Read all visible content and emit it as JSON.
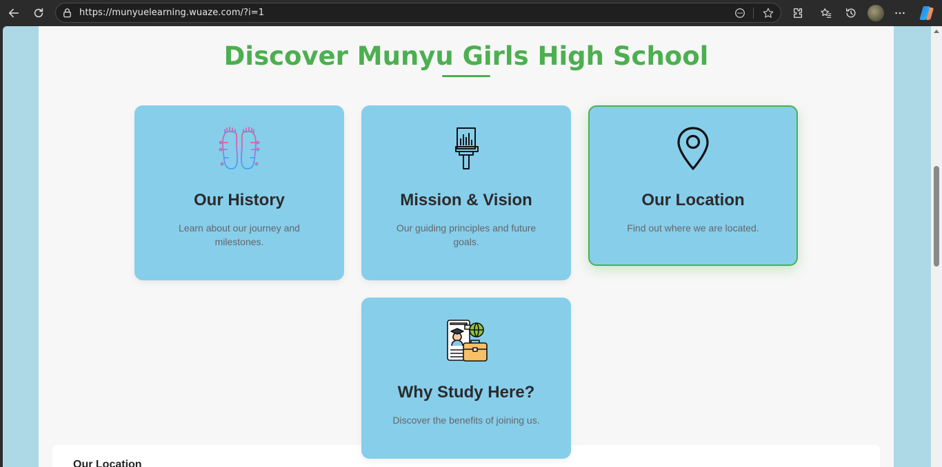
{
  "browser": {
    "url": "https://munyuelearning.wuaze.com/?i=1"
  },
  "page": {
    "title": "Discover Munyu Girls High School",
    "accent_color": "#4caf50",
    "card_color": "#87ceeb",
    "cards": [
      {
        "icon": "feet-icon",
        "title": "Our History",
        "desc": "Learn about our journey and milestones."
      },
      {
        "icon": "paint-brush-icon",
        "title": "Mission & Vision",
        "desc": "Our guiding principles and future goals."
      },
      {
        "icon": "location-pin-icon",
        "title": "Our Location",
        "desc": "Find out where we are located."
      },
      {
        "icon": "study-abroad-icon",
        "title": "Why Study Here?",
        "desc": "Discover the benefits of joining us."
      }
    ],
    "lower_section_title": "Our Location"
  }
}
